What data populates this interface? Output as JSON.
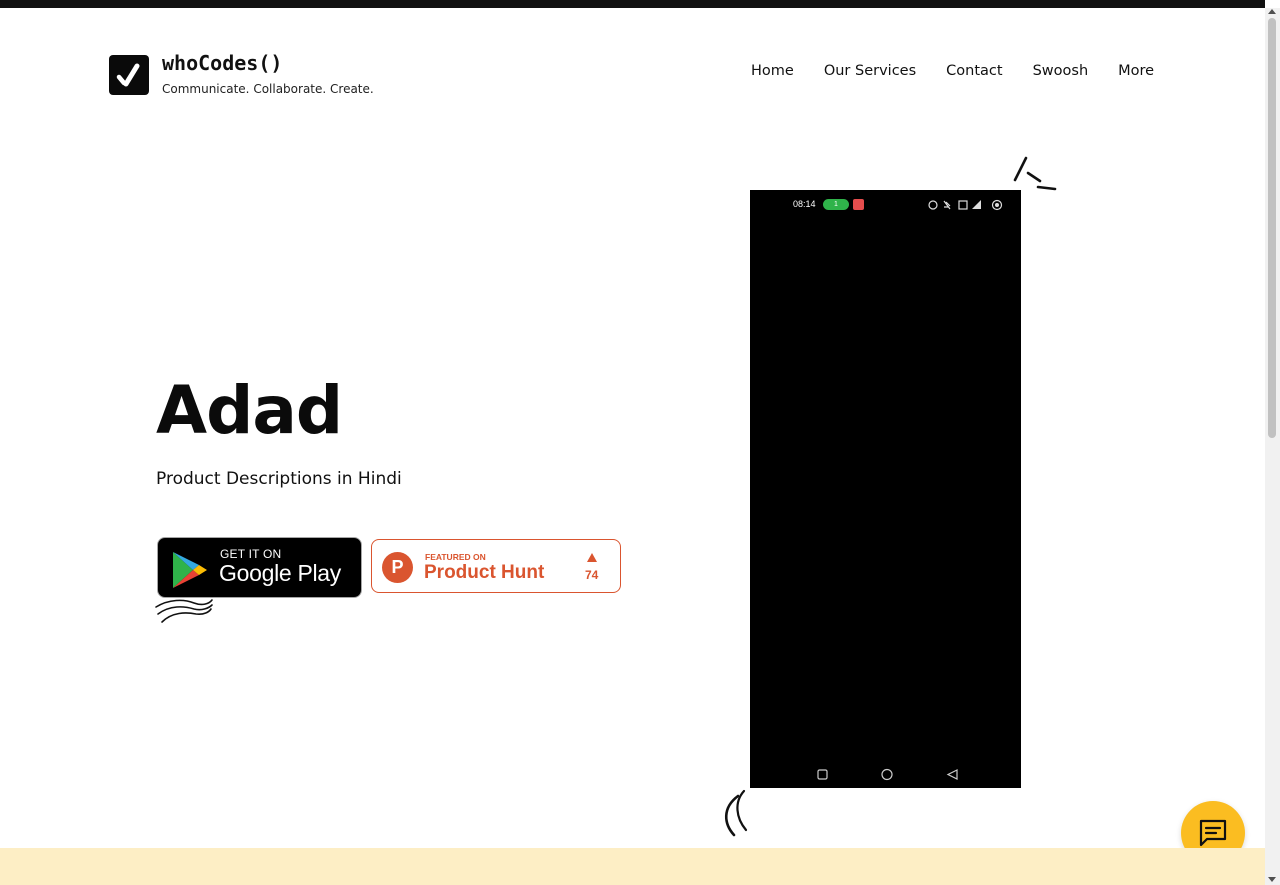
{
  "header": {
    "brand_name": "whoCodes()",
    "tagline": "Communicate. Collaborate. Create.",
    "logo_icon": "checkmark-slash-icon"
  },
  "nav": {
    "items": [
      {
        "label": "Home"
      },
      {
        "label": "Our Services"
      },
      {
        "label": "Contact"
      },
      {
        "label": "Swoosh"
      },
      {
        "label": "More"
      }
    ]
  },
  "hero": {
    "title": "Adad",
    "subtitle": "Product Descriptions in Hindi"
  },
  "badges": {
    "google_play": {
      "small": "GET IT ON",
      "big": "Google Play"
    },
    "product_hunt": {
      "letter": "P",
      "small": "FEATURED ON",
      "big": "Product Hunt",
      "votes": "74"
    }
  },
  "phone": {
    "time": "08:14",
    "pill_text": "1"
  },
  "colors": {
    "accent_yellow": "#fbbd21",
    "product_hunt": "#da552f",
    "band": "#fdeec5"
  },
  "chat": {
    "icon": "chat-message-icon"
  }
}
